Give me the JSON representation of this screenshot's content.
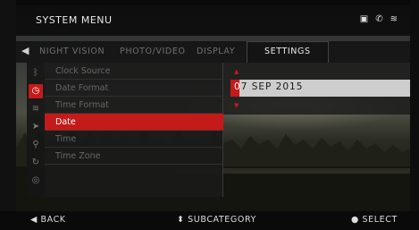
{
  "menu": {
    "title": "SYSTEM MENU",
    "status_icons": [
      "sd-card-icon",
      "gps-icon",
      "wifi-icon"
    ]
  },
  "tabs": [
    {
      "label": "NIGHT VISION",
      "active": false
    },
    {
      "label": "PHOTO/VIDEO",
      "active": false
    },
    {
      "label": "DISPLAY",
      "active": false
    },
    {
      "label": "SETTINGS",
      "active": true
    }
  ],
  "sidebar_icons": [
    {
      "name": "bluetooth-icon",
      "active": false
    },
    {
      "name": "clock-icon",
      "active": true
    },
    {
      "name": "wifi-icon",
      "active": false
    },
    {
      "name": "location-icon",
      "active": false
    },
    {
      "name": "search-icon",
      "active": false
    },
    {
      "name": "refresh-icon",
      "active": false
    },
    {
      "name": "target-icon",
      "active": false
    }
  ],
  "settings_items": [
    {
      "label": "Clock Source",
      "active": false
    },
    {
      "label": "Date Format",
      "active": false
    },
    {
      "label": "Time Format",
      "active": false
    },
    {
      "label": "Date",
      "active": true
    },
    {
      "label": "Time",
      "active": false
    },
    {
      "label": "Time Zone",
      "active": false
    }
  ],
  "date_value": {
    "cursor_digit": "0",
    "rest": "7 SEP 2015"
  },
  "footer": {
    "back": "◀ BACK",
    "subcategory": "⬍ SUBCATEGORY",
    "select": "● SELECT"
  },
  "colors": {
    "accent": "#c51a1a",
    "panel": "#1a1a1a",
    "text_dim": "#676767",
    "text_bright": "#e6e6e6"
  }
}
